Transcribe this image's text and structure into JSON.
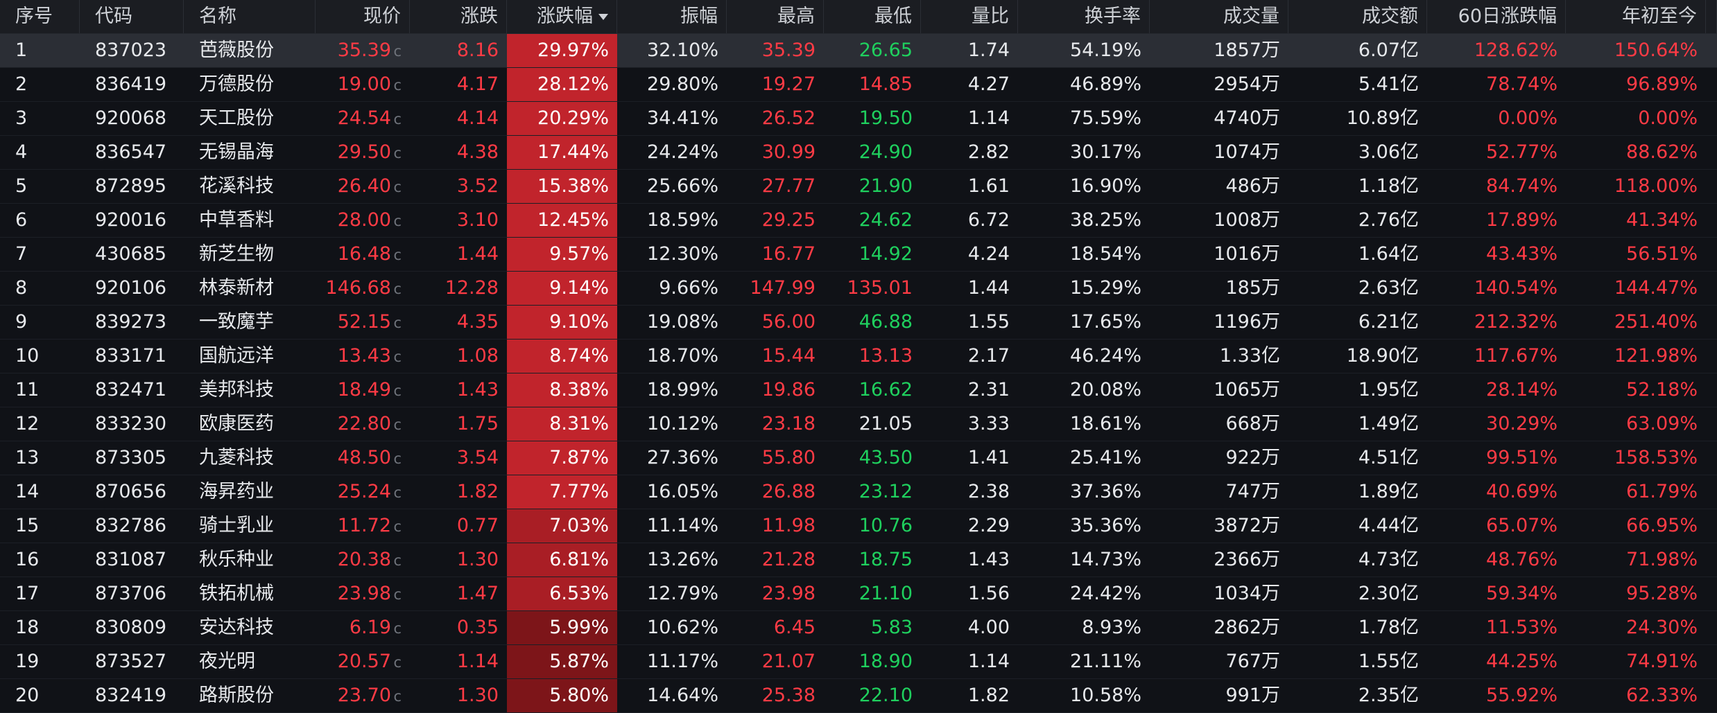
{
  "headers": [
    "序号",
    "代码",
    "名称",
    "现价",
    "涨跌",
    "涨跌幅",
    "振幅",
    "最高",
    "最低",
    "量比",
    "换手率",
    "成交量",
    "成交额",
    "60日涨跌幅",
    "年初至今"
  ],
  "colors": {
    "up": "#ff3b45",
    "down": "#1fd05e",
    "neutral": "#e7e9ec",
    "pct_bg_strong": "#c1242c",
    "pct_bg_mid": "#a91e25",
    "pct_bg_weak": "#7d1519"
  },
  "rows": [
    {
      "seq": "1",
      "code": "837023",
      "name": "芭薇股份",
      "price": "35.39",
      "change": "8.16",
      "pct": "29.97%",
      "amplitude": "32.10%",
      "high": "35.39",
      "low": "26.65",
      "volume_ratio": "1.74",
      "turnover_rate": "54.19%",
      "volume": "1857万",
      "amount": "6.07亿",
      "d60": "128.62%",
      "ytd": "150.64%"
    },
    {
      "seq": "2",
      "code": "836419",
      "name": "万德股份",
      "price": "19.00",
      "change": "4.17",
      "pct": "28.12%",
      "amplitude": "29.80%",
      "high": "19.27",
      "low": "14.85",
      "volume_ratio": "4.27",
      "turnover_rate": "46.89%",
      "volume": "2954万",
      "amount": "5.41亿",
      "d60": "78.74%",
      "ytd": "96.89%"
    },
    {
      "seq": "3",
      "code": "920068",
      "name": "天工股份",
      "price": "24.54",
      "change": "4.14",
      "pct": "20.29%",
      "amplitude": "34.41%",
      "high": "26.52",
      "low": "19.50",
      "volume_ratio": "1.14",
      "turnover_rate": "75.59%",
      "volume": "4740万",
      "amount": "10.89亿",
      "d60": "0.00%",
      "ytd": "0.00%"
    },
    {
      "seq": "4",
      "code": "836547",
      "name": "无锡晶海",
      "price": "29.50",
      "change": "4.38",
      "pct": "17.44%",
      "amplitude": "24.24%",
      "high": "30.99",
      "low": "24.90",
      "volume_ratio": "2.82",
      "turnover_rate": "30.17%",
      "volume": "1074万",
      "amount": "3.06亿",
      "d60": "52.77%",
      "ytd": "88.62%"
    },
    {
      "seq": "5",
      "code": "872895",
      "name": "花溪科技",
      "price": "26.40",
      "change": "3.52",
      "pct": "15.38%",
      "amplitude": "25.66%",
      "high": "27.77",
      "low": "21.90",
      "volume_ratio": "1.61",
      "turnover_rate": "16.90%",
      "volume": "486万",
      "amount": "1.18亿",
      "d60": "84.74%",
      "ytd": "118.00%"
    },
    {
      "seq": "6",
      "code": "920016",
      "name": "中草香料",
      "price": "28.00",
      "change": "3.10",
      "pct": "12.45%",
      "amplitude": "18.59%",
      "high": "29.25",
      "low": "24.62",
      "volume_ratio": "6.72",
      "turnover_rate": "38.25%",
      "volume": "1008万",
      "amount": "2.76亿",
      "d60": "17.89%",
      "ytd": "41.34%"
    },
    {
      "seq": "7",
      "code": "430685",
      "name": "新芝生物",
      "price": "16.48",
      "change": "1.44",
      "pct": "9.57%",
      "amplitude": "12.30%",
      "high": "16.77",
      "low": "14.92",
      "volume_ratio": "4.24",
      "turnover_rate": "18.54%",
      "volume": "1016万",
      "amount": "1.64亿",
      "d60": "43.43%",
      "ytd": "56.51%"
    },
    {
      "seq": "8",
      "code": "920106",
      "name": "林泰新材",
      "price": "146.68",
      "change": "12.28",
      "pct": "9.14%",
      "amplitude": "9.66%",
      "high": "147.99",
      "low": "135.01",
      "volume_ratio": "1.44",
      "turnover_rate": "15.29%",
      "volume": "185万",
      "amount": "2.63亿",
      "d60": "140.54%",
      "ytd": "144.47%"
    },
    {
      "seq": "9",
      "code": "839273",
      "name": "一致魔芋",
      "price": "52.15",
      "change": "4.35",
      "pct": "9.10%",
      "amplitude": "19.08%",
      "high": "56.00",
      "low": "46.88",
      "volume_ratio": "1.55",
      "turnover_rate": "17.65%",
      "volume": "1196万",
      "amount": "6.21亿",
      "d60": "212.32%",
      "ytd": "251.40%"
    },
    {
      "seq": "10",
      "code": "833171",
      "name": "国航远洋",
      "price": "13.43",
      "change": "1.08",
      "pct": "8.74%",
      "amplitude": "18.70%",
      "high": "15.44",
      "low": "13.13",
      "volume_ratio": "2.17",
      "turnover_rate": "46.24%",
      "volume": "1.33亿",
      "amount": "18.90亿",
      "d60": "117.67%",
      "ytd": "121.98%"
    },
    {
      "seq": "11",
      "code": "832471",
      "name": "美邦科技",
      "price": "18.49",
      "change": "1.43",
      "pct": "8.38%",
      "amplitude": "18.99%",
      "high": "19.86",
      "low": "16.62",
      "volume_ratio": "2.31",
      "turnover_rate": "20.08%",
      "volume": "1065万",
      "amount": "1.95亿",
      "d60": "28.14%",
      "ytd": "52.18%"
    },
    {
      "seq": "12",
      "code": "833230",
      "name": "欧康医药",
      "price": "22.80",
      "change": "1.75",
      "pct": "8.31%",
      "amplitude": "10.12%",
      "high": "23.18",
      "low": "21.05",
      "volume_ratio": "3.33",
      "turnover_rate": "18.61%",
      "volume": "668万",
      "amount": "1.49亿",
      "d60": "30.29%",
      "ytd": "63.09%"
    },
    {
      "seq": "13",
      "code": "873305",
      "name": "九菱科技",
      "price": "48.50",
      "change": "3.54",
      "pct": "7.87%",
      "amplitude": "27.36%",
      "high": "55.80",
      "low": "43.50",
      "volume_ratio": "1.41",
      "turnover_rate": "25.41%",
      "volume": "922万",
      "amount": "4.51亿",
      "d60": "99.51%",
      "ytd": "158.53%"
    },
    {
      "seq": "14",
      "code": "870656",
      "name": "海昇药业",
      "price": "25.24",
      "change": "1.82",
      "pct": "7.77%",
      "amplitude": "16.05%",
      "high": "26.88",
      "low": "23.12",
      "volume_ratio": "2.38",
      "turnover_rate": "37.36%",
      "volume": "747万",
      "amount": "1.89亿",
      "d60": "40.69%",
      "ytd": "61.79%"
    },
    {
      "seq": "15",
      "code": "832786",
      "name": "骑士乳业",
      "price": "11.72",
      "change": "0.77",
      "pct": "7.03%",
      "amplitude": "11.14%",
      "high": "11.98",
      "low": "10.76",
      "volume_ratio": "2.29",
      "turnover_rate": "35.36%",
      "volume": "3872万",
      "amount": "4.44亿",
      "d60": "65.07%",
      "ytd": "66.95%"
    },
    {
      "seq": "16",
      "code": "831087",
      "name": "秋乐种业",
      "price": "20.38",
      "change": "1.30",
      "pct": "6.81%",
      "amplitude": "13.26%",
      "high": "21.28",
      "low": "18.75",
      "volume_ratio": "1.43",
      "turnover_rate": "14.73%",
      "volume": "2366万",
      "amount": "4.73亿",
      "d60": "48.76%",
      "ytd": "71.98%"
    },
    {
      "seq": "17",
      "code": "873706",
      "name": "铁拓机械",
      "price": "23.98",
      "change": "1.47",
      "pct": "6.53%",
      "amplitude": "12.79%",
      "high": "23.98",
      "low": "21.10",
      "volume_ratio": "1.56",
      "turnover_rate": "24.42%",
      "volume": "1034万",
      "amount": "2.30亿",
      "d60": "59.34%",
      "ytd": "95.28%"
    },
    {
      "seq": "18",
      "code": "830809",
      "name": "安达科技",
      "price": "6.19",
      "change": "0.35",
      "pct": "5.99%",
      "amplitude": "10.62%",
      "high": "6.45",
      "low": "5.83",
      "volume_ratio": "4.00",
      "turnover_rate": "8.93%",
      "volume": "2862万",
      "amount": "1.78亿",
      "d60": "11.53%",
      "ytd": "24.30%"
    },
    {
      "seq": "19",
      "code": "873527",
      "name": "夜光明",
      "price": "20.57",
      "change": "1.14",
      "pct": "5.87%",
      "amplitude": "11.17%",
      "high": "21.07",
      "low": "18.90",
      "volume_ratio": "1.14",
      "turnover_rate": "21.11%",
      "volume": "767万",
      "amount": "1.55亿",
      "d60": "44.25%",
      "ytd": "74.91%"
    },
    {
      "seq": "20",
      "code": "832419",
      "name": "路斯股份",
      "price": "23.70",
      "change": "1.30",
      "pct": "5.80%",
      "amplitude": "14.64%",
      "high": "25.38",
      "low": "22.10",
      "volume_ratio": "1.82",
      "turnover_rate": "10.58%",
      "volume": "991万",
      "amount": "2.35亿",
      "d60": "55.92%",
      "ytd": "62.33%"
    }
  ],
  "price_suffix": "c"
}
